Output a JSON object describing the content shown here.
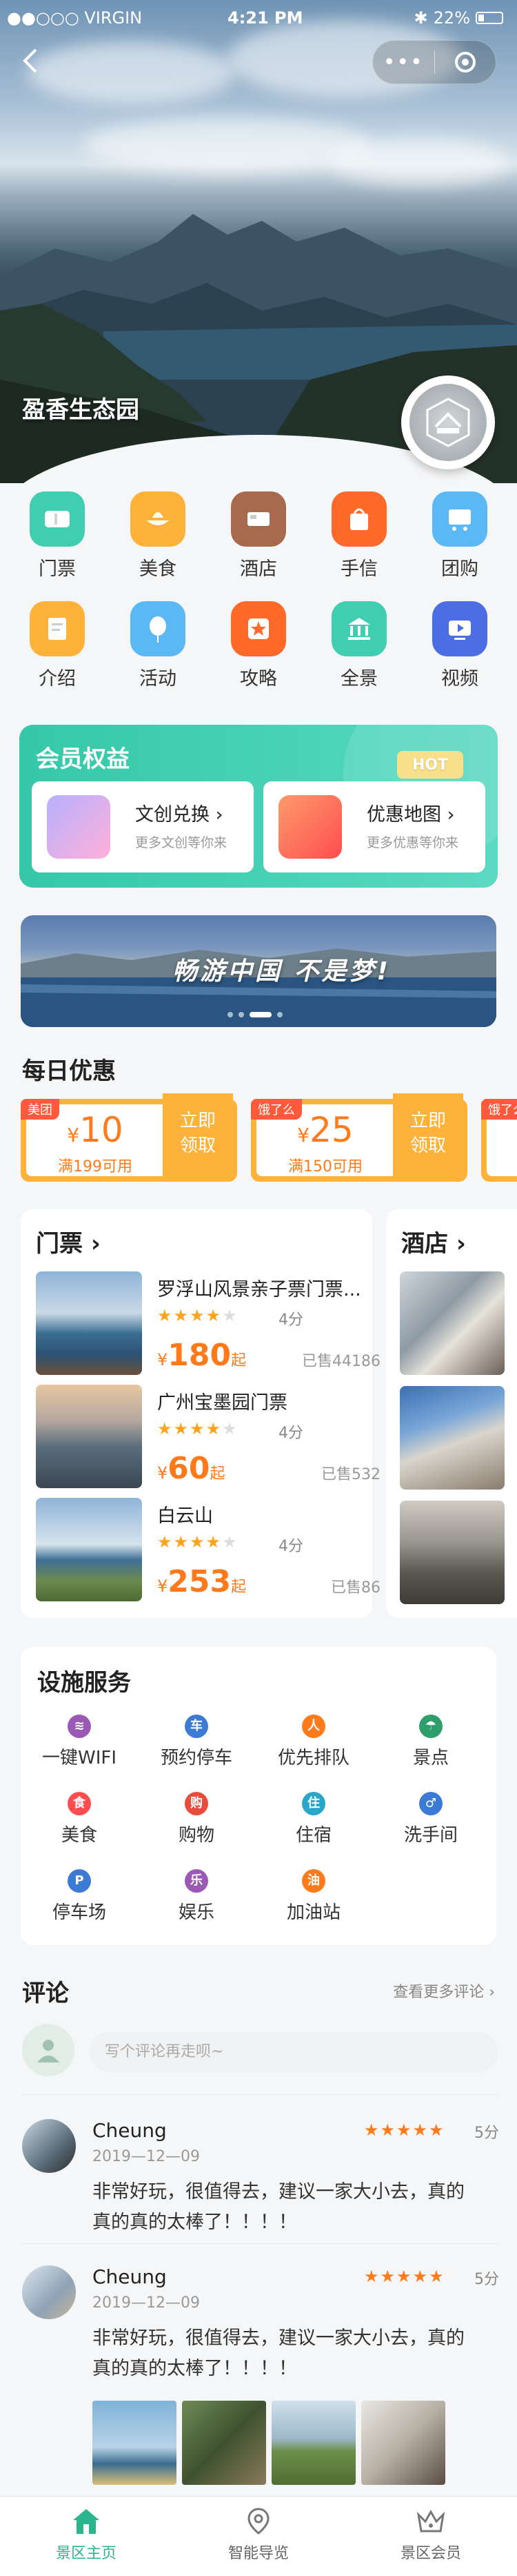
{
  "status_bar": {
    "carrier": "●●○○○ VIRGIN",
    "time": "4:21 PM",
    "battery": "22%"
  },
  "hero": {
    "park_name": "盈香生态园"
  },
  "icon_grid": [
    {
      "label": "门票",
      "icon": "ticket-icon",
      "color": "#3fcfb0"
    },
    {
      "label": "美食",
      "icon": "food-icon",
      "color": "#ffb23a"
    },
    {
      "label": "酒店",
      "icon": "hotel-bed-icon",
      "color": "#a86a4c"
    },
    {
      "label": "手信",
      "icon": "gift-bag-icon",
      "color": "#ff6a2b"
    },
    {
      "label": "团购",
      "icon": "group-buy-icon",
      "color": "#5ab8f5"
    },
    {
      "label": "介绍",
      "icon": "intro-doc-icon",
      "color": "#ffb23a"
    },
    {
      "label": "活动",
      "icon": "balloon-icon",
      "color": "#5ab8f5"
    },
    {
      "label": "攻略",
      "icon": "guide-star-icon",
      "color": "#ff6a2b"
    },
    {
      "label": "全景",
      "icon": "panorama-building-icon",
      "color": "#3fcfb0"
    },
    {
      "label": "视频",
      "icon": "video-play-icon",
      "color": "#4c6ee5"
    }
  ],
  "member": {
    "title": "会员权益",
    "hot": "HOT",
    "cards": [
      {
        "title": "文创兑换",
        "sub": "更多文创等你来"
      },
      {
        "title": "优惠地图",
        "sub": "更多优惠等你来"
      }
    ]
  },
  "banner": {
    "text": "畅游中国 不是梦!"
  },
  "deals": {
    "title": "每日优惠",
    "items": [
      {
        "tag": "美团",
        "amount": "10",
        "currency": "¥",
        "condition": "满199可用",
        "button": "立即领取"
      },
      {
        "tag": "饿了么",
        "amount": "25",
        "currency": "¥",
        "condition": "满150可用",
        "button": "立即领取"
      },
      {
        "tag": "饿了么",
        "amount": "",
        "currency": "",
        "condition": "",
        "button": ""
      }
    ]
  },
  "tickets": {
    "title": "门票",
    "items": [
      {
        "name": "罗浮山风景亲子票门票...",
        "score": "4分",
        "rating": 4,
        "price": "180",
        "currency": "¥",
        "suffix": "起",
        "sold": "已售44186"
      },
      {
        "name": "广州宝墨园门票",
        "score": "4分",
        "rating": 4,
        "price": "60",
        "currency": "¥",
        "suffix": "起",
        "sold": "已售532"
      },
      {
        "name": "白云山",
        "score": "4分",
        "rating": 4,
        "price": "253",
        "currency": "¥",
        "suffix": "起",
        "sold": "已售86"
      }
    ]
  },
  "hotel": {
    "title": "酒店"
  },
  "facilities": {
    "title": "设施服务",
    "items": [
      {
        "label": "一键WIFI",
        "color": "#9b59b6",
        "glyph": "≋"
      },
      {
        "label": "预约停车",
        "color": "#3b7bd6",
        "glyph": "车"
      },
      {
        "label": "优先排队",
        "color": "#ff7a1a",
        "glyph": "人"
      },
      {
        "label": "景点",
        "color": "#2e9e6a",
        "glyph": "☂"
      },
      {
        "label": "美食",
        "color": "#ff4d4f",
        "glyph": "食"
      },
      {
        "label": "购物",
        "color": "#e74c3c",
        "glyph": "购"
      },
      {
        "label": "住宿",
        "color": "#2aa6c9",
        "glyph": "住"
      },
      {
        "label": "洗手间",
        "color": "#3b7bd6",
        "glyph": "♂"
      },
      {
        "label": "停车场",
        "color": "#3b7bd6",
        "glyph": "P"
      },
      {
        "label": "娱乐",
        "color": "#9b59b6",
        "glyph": "乐"
      },
      {
        "label": "加油站",
        "color": "#ff7a1a",
        "glyph": "油"
      }
    ]
  },
  "comments": {
    "title": "评论",
    "more": "查看更多评论",
    "input_placeholder": "写个评论再走呗~",
    "reviews": [
      {
        "name": "Cheung",
        "date": "2019—12—09",
        "score": "5分",
        "rating": 5,
        "text": "非常好玩，很值得去，建议一家大小去，真的真的真的太棒了！！！！"
      },
      {
        "name": "Cheung",
        "date": "2019—12—09",
        "score": "5分",
        "rating": 5,
        "text": "非常好玩，很值得去，建议一家大小去，真的真的真的太棒了！！！！"
      }
    ]
  },
  "tabbar": [
    {
      "label": "景区主页",
      "active": true
    },
    {
      "label": "智能导览",
      "active": false
    },
    {
      "label": "景区会员",
      "active": false
    }
  ]
}
